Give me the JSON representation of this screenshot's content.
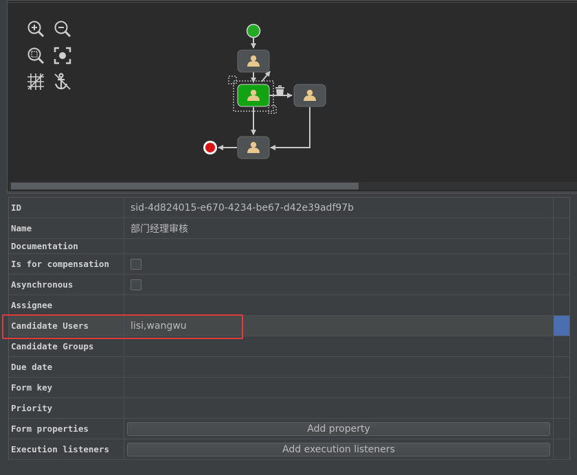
{
  "toolbar": {
    "zoom_in": "zoom-in-icon",
    "zoom_out": "zoom-out-icon",
    "zoom_actual": "zoom-actual-icon",
    "zoom_fit": "zoom-fit-icon",
    "grid": "grid-icon",
    "anchor": "anchor-icon"
  },
  "diagram": {
    "colors": {
      "start_event": "#22aa22",
      "end_event": "#dd1111",
      "task": "#4e5254",
      "task_selected": "#11a311",
      "connector": "#c8c8c8"
    }
  },
  "properties": {
    "rows": [
      {
        "key": "ID",
        "value": "sid-4d824015-e670-4234-be67-d42e39adf97b"
      },
      {
        "key": "Name",
        "value": "部门经理审核"
      },
      {
        "key": "Documentation",
        "value": ""
      },
      {
        "key": "Is for compensation",
        "value": ""
      },
      {
        "key": "Asynchronous",
        "value": ""
      },
      {
        "key": "Assignee",
        "value": ""
      },
      {
        "key": "Candidate Users",
        "value": "lisi,wangwu"
      },
      {
        "key": "Candidate Groups",
        "value": ""
      },
      {
        "key": "Due date",
        "value": ""
      },
      {
        "key": "Form key",
        "value": ""
      },
      {
        "key": "Priority",
        "value": ""
      },
      {
        "key": "Form properties",
        "value": "Add property"
      },
      {
        "key": "Execution listeners",
        "value": "Add execution listeners"
      }
    ]
  },
  "highlight_color": "#e03c3c"
}
